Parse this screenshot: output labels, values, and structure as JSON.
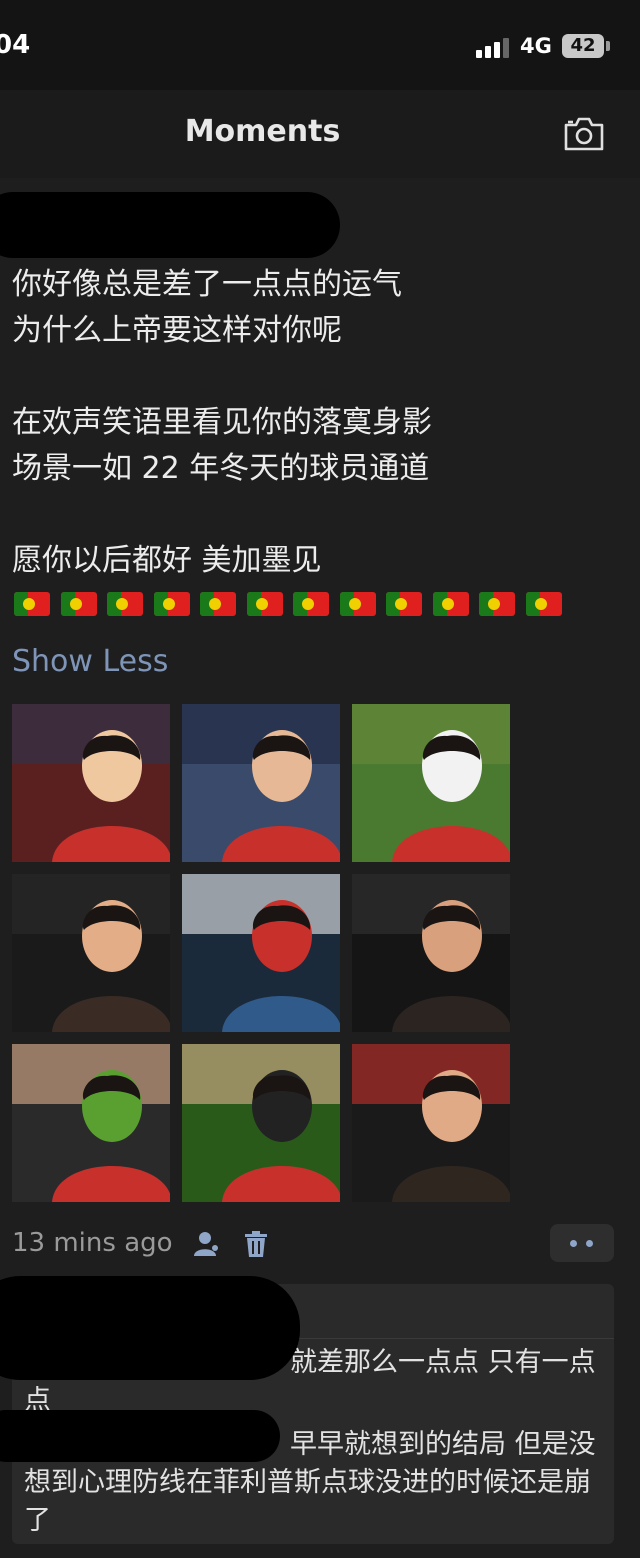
{
  "status_bar": {
    "time": "04",
    "network": "4G",
    "battery": "42"
  },
  "header": {
    "title": "Moments",
    "camera_icon": "camera-icon"
  },
  "post": {
    "text": "你好像总是差了一点点的运气\n为什么上帝要这样对你呢\n\n在欢声笑语里看见你的落寞身影\n场景一如 22 年冬天的球员通道\n\n愿你以后都好 美加墨见",
    "flag_emoji": "🇵🇹",
    "flag_count": 12,
    "show_less": "Show Less",
    "photo_count": 9,
    "timestamp": "13 mins ago",
    "visibility_icon": "person-icon",
    "delete_icon": "trash-icon",
    "more_icon": "more-dots-icon"
  },
  "comments": [
    {
      "text": "就差那么一点点 只有一点点"
    },
    {
      "text": "早早就想到的结局 但是没想到心理防线在菲利普斯点球没进的时候还是崩了"
    }
  ],
  "colors": {
    "background": "#151515",
    "card": "#1e1e1e",
    "comment_box": "#2a2a2a",
    "link": "#7e95b8",
    "muted": "#9a9a9a"
  }
}
